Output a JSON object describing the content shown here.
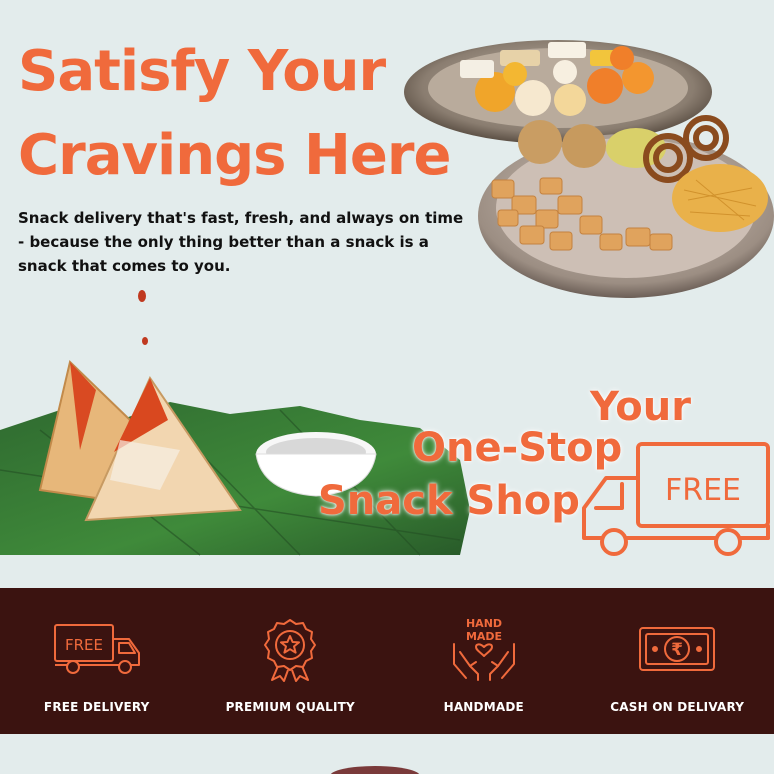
{
  "hero": {
    "title_line1": "Satisfy Your",
    "title_line2": "Cravings Here",
    "subtitle": "Snack delivery that's fast, fresh, and always on time - because the only thing better than a snack is a snack that comes to you."
  },
  "tagline": {
    "line1": "Your",
    "line2": "One-Stop",
    "line3": "Snack Shop",
    "truck_badge": "FREE"
  },
  "features": [
    {
      "label": "FREE DELIVERY",
      "icon": "delivery-truck-icon",
      "badge": "FREE"
    },
    {
      "label": "PREMIUM QUALITY",
      "icon": "award-badge-icon"
    },
    {
      "label": "HANDMADE",
      "icon": "handmade-hands-icon",
      "badge_line1": "HAND",
      "badge_line2": "MADE"
    },
    {
      "label": "CASH ON DELIVARY",
      "icon": "rupee-cash-icon",
      "symbol": "₹"
    }
  ],
  "colors": {
    "accent": "#f06a3c",
    "band": "#3b1310",
    "background": "#e3ecec"
  }
}
